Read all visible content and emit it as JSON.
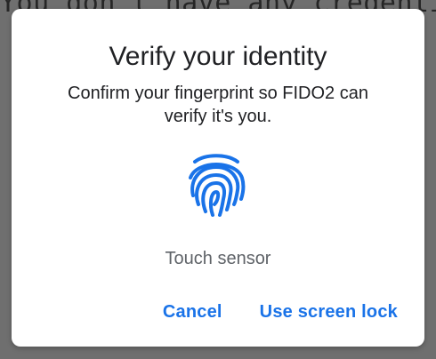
{
  "background": {
    "text": "You don't have any credentials"
  },
  "dialog": {
    "title": "Verify your identity",
    "message": "Confirm your fingerprint so FIDO2 can verify it's you.",
    "icon": "fingerprint-icon",
    "status": "Touch sensor",
    "actions": {
      "cancel_label": "Cancel",
      "screen_lock_label": "Use screen lock"
    }
  },
  "colors": {
    "accent": "#1a73e8",
    "scrim": "#6f6f6f"
  }
}
